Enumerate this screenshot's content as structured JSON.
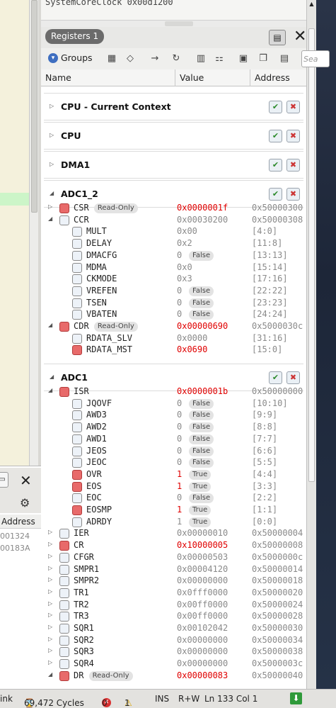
{
  "window": {
    "tab_label": "Registers 1",
    "search_placeholder": "Sea"
  },
  "top_strip": {
    "row_text": "SystemCoreClock          0x00d1200"
  },
  "toolbar": {
    "groups_label": "Groups"
  },
  "columns": {
    "name": "Name",
    "value": "Value",
    "address": "Address"
  },
  "left_pane": {
    "header": "Address",
    "values": [
      "001324",
      "00183A"
    ],
    "hidden_tab": "ink"
  },
  "groups": [
    {
      "name": "CPU - Current Context",
      "expanded": false
    },
    {
      "name": "CPU",
      "expanded": false
    },
    {
      "name": "DMA1",
      "expanded": false
    },
    {
      "name": "ADC1_2",
      "expanded": true
    },
    {
      "name": "ADC1",
      "expanded": true
    }
  ],
  "adc12_rows": [
    {
      "name": "CSR",
      "pill": "Read-Only",
      "value": "0x0000001f",
      "value_red": true,
      "addr": "0x50000300",
      "level": 0,
      "box": "red",
      "twisty": "▷"
    },
    {
      "name": "CCR",
      "pill": "",
      "value": "0x00030200",
      "value_red": false,
      "addr": "0x50000308",
      "level": 0,
      "box": "blue",
      "twisty": "◢"
    },
    {
      "name": "MULT",
      "pill": "",
      "value": "0x00",
      "value_red": false,
      "addr": "[4:0]",
      "level": 1,
      "box": "blue"
    },
    {
      "name": "DELAY",
      "pill": "",
      "value": "0x2",
      "value_red": false,
      "addr": "[11:8]",
      "level": 1,
      "box": "blue"
    },
    {
      "name": "DMACFG",
      "pill": "",
      "value": "0",
      "vpill": "False",
      "value_red": false,
      "addr": "[13:13]",
      "level": 1,
      "box": "blue"
    },
    {
      "name": "MDMA",
      "pill": "",
      "value": "0x0",
      "value_red": false,
      "addr": "[15:14]",
      "level": 1,
      "box": "blue"
    },
    {
      "name": "CKMODE",
      "pill": "",
      "value": "0x3",
      "value_red": false,
      "addr": "[17:16]",
      "level": 1,
      "box": "blue"
    },
    {
      "name": "VREFEN",
      "pill": "",
      "value": "0",
      "vpill": "False",
      "value_red": false,
      "addr": "[22:22]",
      "level": 1,
      "box": "blue"
    },
    {
      "name": "TSEN",
      "pill": "",
      "value": "0",
      "vpill": "False",
      "value_red": false,
      "addr": "[23:23]",
      "level": 1,
      "box": "blue"
    },
    {
      "name": "VBATEN",
      "pill": "",
      "value": "0",
      "vpill": "False",
      "value_red": false,
      "addr": "[24:24]",
      "level": 1,
      "box": "blue"
    },
    {
      "name": "CDR",
      "pill": "Read-Only",
      "value": "0x00000690",
      "value_red": true,
      "addr": "0x5000030c",
      "level": 0,
      "box": "red",
      "twisty": "◢"
    },
    {
      "name": "RDATA_SLV",
      "pill": "",
      "value": "0x0000",
      "value_red": false,
      "addr": "[31:16]",
      "level": 1,
      "box": "blue"
    },
    {
      "name": "RDATA_MST",
      "pill": "",
      "value": "0x0690",
      "value_red": true,
      "addr": "[15:0]",
      "level": 1,
      "box": "red"
    }
  ],
  "adc1_rows": [
    {
      "name": "ISR",
      "pill": "",
      "value": "0x0000001b",
      "value_red": true,
      "addr": "0x50000000",
      "level": 0,
      "box": "red",
      "twisty": "◢"
    },
    {
      "name": "JQOVF",
      "pill": "",
      "value": "0",
      "vpill": "False",
      "value_red": false,
      "addr": "[10:10]",
      "level": 1,
      "box": "blue"
    },
    {
      "name": "AWD3",
      "pill": "",
      "value": "0",
      "vpill": "False",
      "value_red": false,
      "addr": "[9:9]",
      "level": 1,
      "box": "blue"
    },
    {
      "name": "AWD2",
      "pill": "",
      "value": "0",
      "vpill": "False",
      "value_red": false,
      "addr": "[8:8]",
      "level": 1,
      "box": "blue"
    },
    {
      "name": "AWD1",
      "pill": "",
      "value": "0",
      "vpill": "False",
      "value_red": false,
      "addr": "[7:7]",
      "level": 1,
      "box": "blue"
    },
    {
      "name": "JEOS",
      "pill": "",
      "value": "0",
      "vpill": "False",
      "value_red": false,
      "addr": "[6:6]",
      "level": 1,
      "box": "blue"
    },
    {
      "name": "JEOC",
      "pill": "",
      "value": "0",
      "vpill": "False",
      "value_red": false,
      "addr": "[5:5]",
      "level": 1,
      "box": "blue"
    },
    {
      "name": "OVR",
      "pill": "",
      "value": "1",
      "vpill": "True",
      "value_red": true,
      "addr": "[4:4]",
      "level": 1,
      "box": "red"
    },
    {
      "name": "EOS",
      "pill": "",
      "value": "1",
      "vpill": "True",
      "value_red": true,
      "addr": "[3:3]",
      "level": 1,
      "box": "red"
    },
    {
      "name": "EOC",
      "pill": "",
      "value": "0",
      "vpill": "False",
      "value_red": false,
      "addr": "[2:2]",
      "level": 1,
      "box": "blue"
    },
    {
      "name": "EOSMP",
      "pill": "",
      "value": "1",
      "vpill": "True",
      "value_red": true,
      "addr": "[1:1]",
      "level": 1,
      "box": "red"
    },
    {
      "name": "ADRDY",
      "pill": "",
      "value": "1",
      "vpill": "True",
      "value_red": false,
      "addr": "[0:0]",
      "level": 1,
      "box": "blue"
    },
    {
      "name": "IER",
      "pill": "",
      "value": "0x00000010",
      "value_red": false,
      "addr": "0x50000004",
      "level": 0,
      "box": "blue",
      "twisty": "▷"
    },
    {
      "name": "CR",
      "pill": "",
      "value": "0x10000005",
      "value_red": true,
      "addr": "0x50000008",
      "level": 0,
      "box": "red",
      "twisty": "▷"
    },
    {
      "name": "CFGR",
      "pill": "",
      "value": "0x00000503",
      "value_red": false,
      "addr": "0x5000000c",
      "level": 0,
      "box": "blue",
      "twisty": "▷"
    },
    {
      "name": "SMPR1",
      "pill": "",
      "value": "0x00004120",
      "value_red": false,
      "addr": "0x50000014",
      "level": 0,
      "box": "blue",
      "twisty": "▷"
    },
    {
      "name": "SMPR2",
      "pill": "",
      "value": "0x00000000",
      "value_red": false,
      "addr": "0x50000018",
      "level": 0,
      "box": "blue",
      "twisty": "▷"
    },
    {
      "name": "TR1",
      "pill": "",
      "value": "0x0fff0000",
      "value_red": false,
      "addr": "0x50000020",
      "level": 0,
      "box": "blue",
      "twisty": "▷"
    },
    {
      "name": "TR2",
      "pill": "",
      "value": "0x00ff0000",
      "value_red": false,
      "addr": "0x50000024",
      "level": 0,
      "box": "blue",
      "twisty": "▷"
    },
    {
      "name": "TR3",
      "pill": "",
      "value": "0x00ff0000",
      "value_red": false,
      "addr": "0x50000028",
      "level": 0,
      "box": "blue",
      "twisty": "▷"
    },
    {
      "name": "SQR1",
      "pill": "",
      "value": "0x00102042",
      "value_red": false,
      "addr": "0x50000030",
      "level": 0,
      "box": "blue",
      "twisty": "▷"
    },
    {
      "name": "SQR2",
      "pill": "",
      "value": "0x00000000",
      "value_red": false,
      "addr": "0x50000034",
      "level": 0,
      "box": "blue",
      "twisty": "▷"
    },
    {
      "name": "SQR3",
      "pill": "",
      "value": "0x00000000",
      "value_red": false,
      "addr": "0x50000038",
      "level": 0,
      "box": "blue",
      "twisty": "▷"
    },
    {
      "name": "SQR4",
      "pill": "",
      "value": "0x00000000",
      "value_red": false,
      "addr": "0x5000003c",
      "level": 0,
      "box": "blue",
      "twisty": "▷"
    },
    {
      "name": "DR",
      "pill": "Read-Only",
      "value": "0x00000083",
      "value_red": true,
      "addr": "0x50000040",
      "level": 0,
      "box": "red",
      "twisty": "◢"
    }
  ],
  "status": {
    "link": "ink",
    "cycles": "69,472 Cycles",
    "errors": "0",
    "warnings": "1",
    "ins": "INS",
    "rw": "R+W",
    "position": "Ln 133 Col 1"
  },
  "colors": {
    "accent": "#3e6ec0",
    "value_changed": "#e00000",
    "tab_bg": "#6b6b6b",
    "ok": "#2f9a3a"
  }
}
